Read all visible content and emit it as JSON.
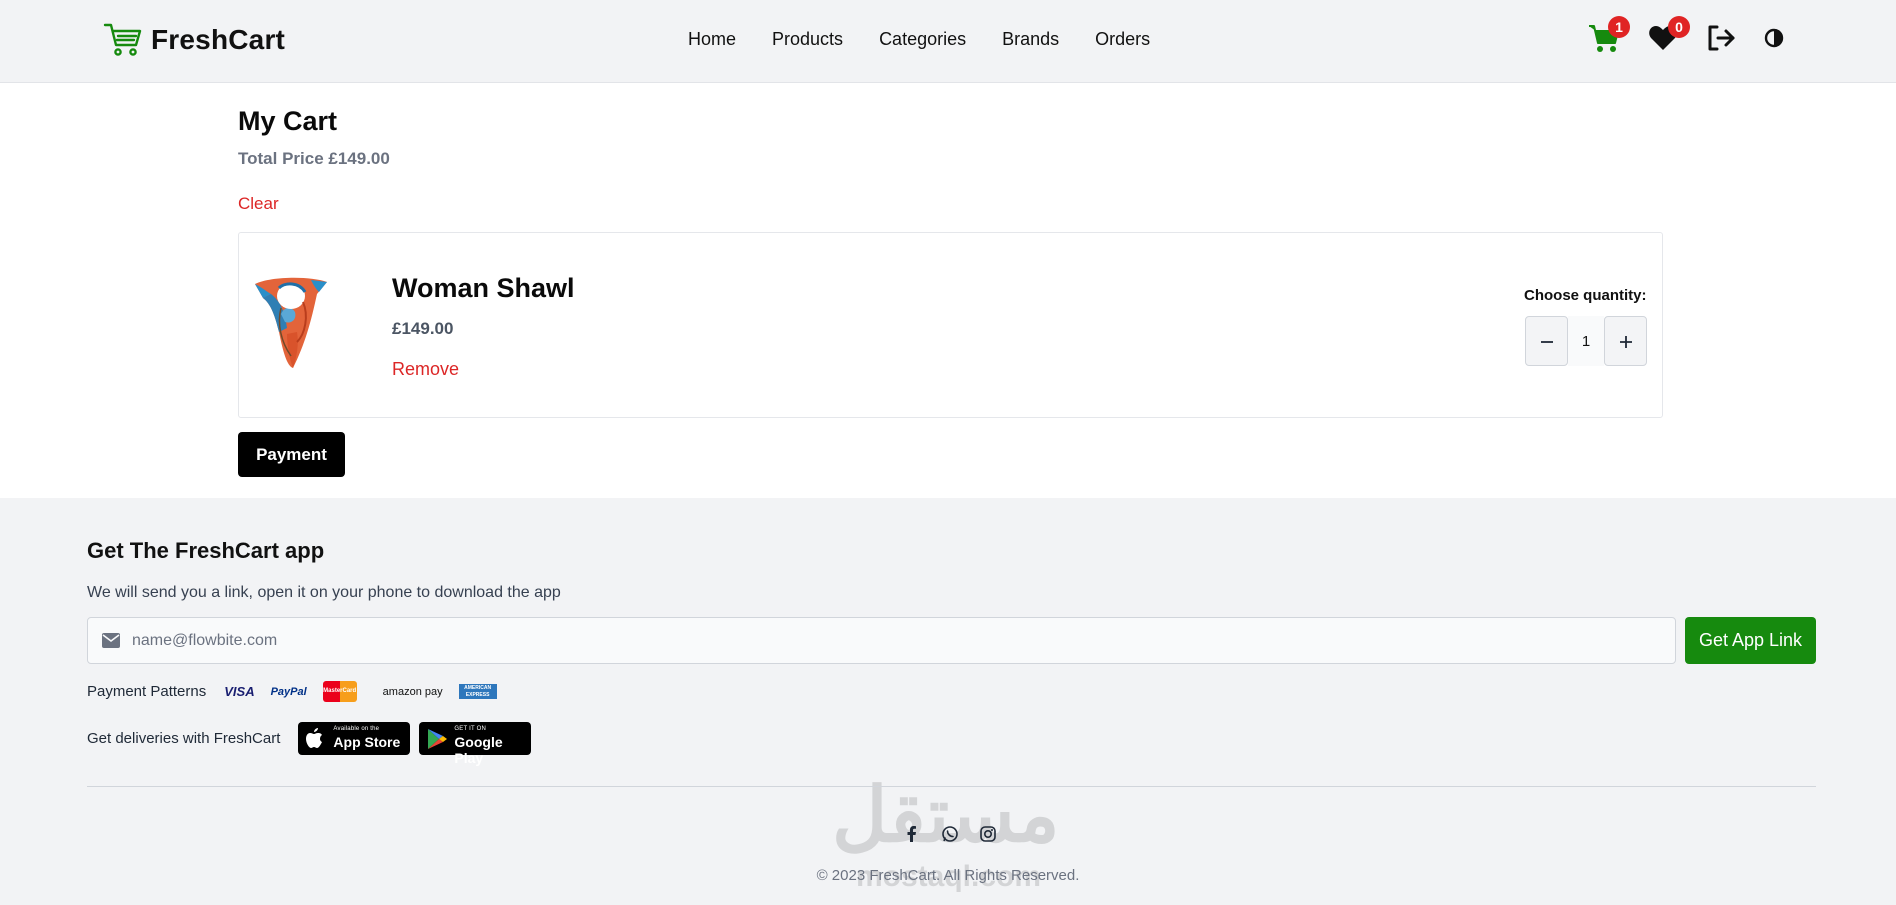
{
  "navbar": {
    "brand": "FreshCart",
    "links": [
      "Home",
      "Products",
      "Categories",
      "Brands",
      "Orders"
    ],
    "cart_count": "1",
    "wishlist_count": "0",
    "colors": {
      "brand_green": "#168a0e",
      "badge_red": "#e02424"
    }
  },
  "cart": {
    "title": "My Cart",
    "total_label": "Total Price £149.00",
    "clear_label": "Clear",
    "items": [
      {
        "name": "Woman Shawl",
        "price": "£149.00",
        "remove_label": "Remove",
        "qty_label": "Choose quantity:",
        "quantity": "1",
        "image_icon": "shawl-image"
      }
    ],
    "payment_label": "Payment"
  },
  "footer": {
    "title": "Get The FreshCart app",
    "subtitle": "We will send you a link, open it on your phone to download the app",
    "email_placeholder": "name@flowbite.com",
    "app_button": "Get App Link",
    "payment_label": "Payment Patterns",
    "payment_logos": [
      "VISA",
      "PayPal",
      "MasterCard",
      "amazon pay",
      "AMERICAN EXPRESS"
    ],
    "delivery_label": "Get deliveries with FreshCart",
    "app_store": {
      "small": "Available on the",
      "big": "App Store"
    },
    "google_play": {
      "small": "GET IT ON",
      "big": "Google Play"
    },
    "socials": [
      "facebook-icon",
      "whatsapp-icon",
      "instagram-icon"
    ],
    "copyright": "© 2023 FreshCart. All Rights Reserved.",
    "watermark": {
      "arabic": "مستقل",
      "latin": "mostaql.com"
    }
  }
}
